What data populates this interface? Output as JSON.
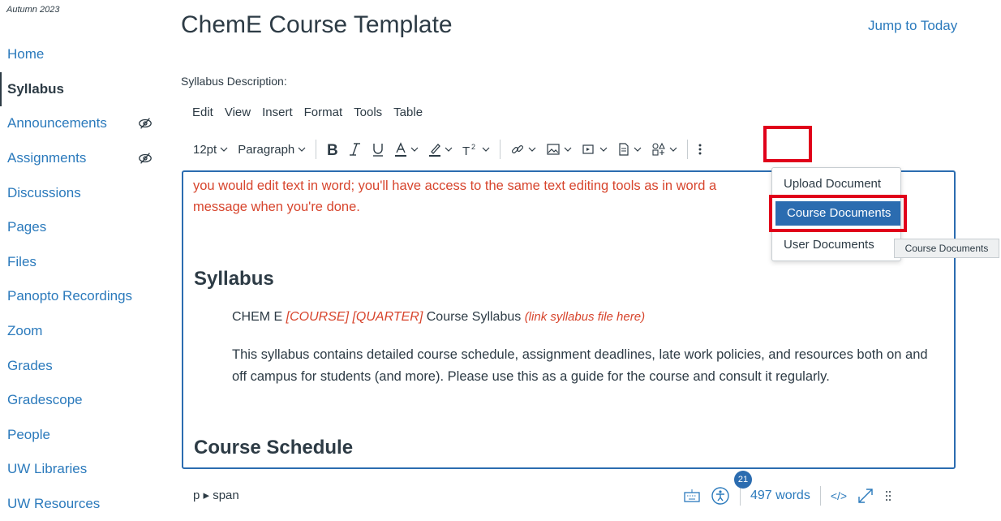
{
  "term": "Autumn 2023",
  "sidebar": {
    "items": [
      {
        "label": "Home"
      },
      {
        "label": "Syllabus"
      },
      {
        "label": "Announcements"
      },
      {
        "label": "Assignments"
      },
      {
        "label": "Discussions"
      },
      {
        "label": "Pages"
      },
      {
        "label": "Files"
      },
      {
        "label": "Panopto Recordings"
      },
      {
        "label": "Zoom"
      },
      {
        "label": "Grades"
      },
      {
        "label": "Gradescope"
      },
      {
        "label": "People"
      },
      {
        "label": "UW Libraries"
      },
      {
        "label": "UW Resources"
      }
    ],
    "active": "Syllabus",
    "hidden_icon": "eye-slash-icon"
  },
  "header": {
    "title": "ChemE Course Template",
    "jump_label": "Jump to Today"
  },
  "editor": {
    "label": "Syllabus Description:",
    "menus": [
      "Edit",
      "View",
      "Insert",
      "Format",
      "Tools",
      "Table"
    ],
    "font_size": "12pt",
    "block_format": "Paragraph",
    "content": {
      "intro": "you would edit text in word; you'll have access to the same text editing tools as in word a",
      "intro2": "message when you're done.",
      "syllabus_heading": "Syllabus",
      "line_prefix": "CHEM E ",
      "line_course": "[COURSE] [QUARTER]",
      "line_mid": " Course Syllabus ",
      "line_link": "(link syllabus file here)",
      "paragraph": "This syllabus contains detailed course schedule, assignment deadlines, late work policies, and resources both on and off campus for students (and more). Please use this as a guide for the course and consult it regularly.",
      "schedule_heading": "Course Schedule"
    }
  },
  "documents_menu": {
    "items": [
      "Upload Document",
      "Course Documents",
      "User Documents"
    ],
    "selected": "Course Documents",
    "tooltip": "Course Documents"
  },
  "statusbar": {
    "path": "p ▸ span",
    "a11y_count": "21",
    "word_count": "497 words",
    "html_toggle": "</>"
  },
  "colors": {
    "link": "#2b7abc",
    "text": "#2d3b45",
    "accent_red": "#d7452d",
    "highlight_box": "#e0001a",
    "selected_bg": "#2b6cb0"
  }
}
